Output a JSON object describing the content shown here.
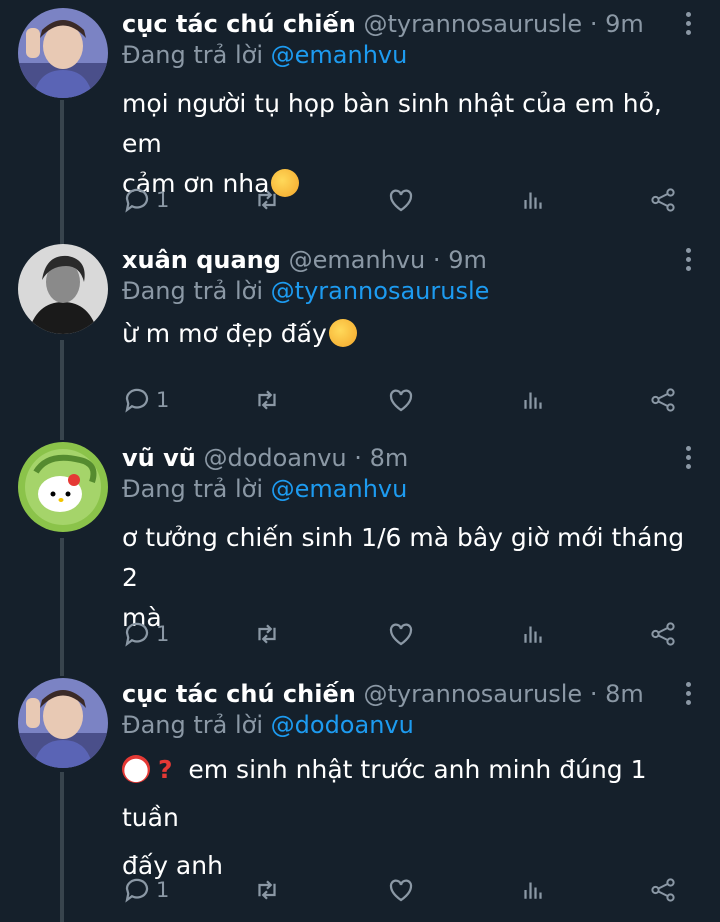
{
  "tweets": [
    {
      "name": "cục tác chú chiến",
      "handle": "@tyrannosaurusle",
      "time": "9m",
      "reply_prefix": "Đang trả lời",
      "reply_to": "@emanhvu",
      "body": "mọi người tụ họp bàn sinh nhật của em hỏ, em\ncảm ơn nha",
      "reply_count": "1",
      "avatar_icon": "avatar-photo-icon"
    },
    {
      "name": "xuân quang",
      "handle": "@emanhvu",
      "time": "9m",
      "reply_prefix": "Đang trả lời",
      "reply_to": "@tyrannosaurusle",
      "body": "ừ m mơ đẹp đấy",
      "reply_count": "1",
      "avatar_icon": "avatar-photo-icon"
    },
    {
      "name": "vũ vũ",
      "handle": "@dodoanvu",
      "time": "8m",
      "reply_prefix": "Đang trả lời",
      "reply_to": "@emanhvu",
      "body": "ơ tưởng chiến sinh 1/6 mà bây giờ mới tháng 2\nmà",
      "reply_count": "1",
      "avatar_icon": "hello-kitty-avatar-icon"
    },
    {
      "name": "cục tác chú chiến",
      "handle": "@tyrannosaurusle",
      "time": "8m",
      "reply_prefix": "Đang trả lời",
      "reply_to": "@dodoanvu",
      "body": "em sinh nhật trước anh minh đúng 1 tuần\nđấy anh",
      "reply_count": "1",
      "avatar_icon": "avatar-photo-icon"
    }
  ],
  "separator": "·",
  "colors": {
    "background": "#15202b",
    "secondary_text": "#8b98a5",
    "link": "#1d9bf0",
    "thread_line": "#38444d"
  }
}
